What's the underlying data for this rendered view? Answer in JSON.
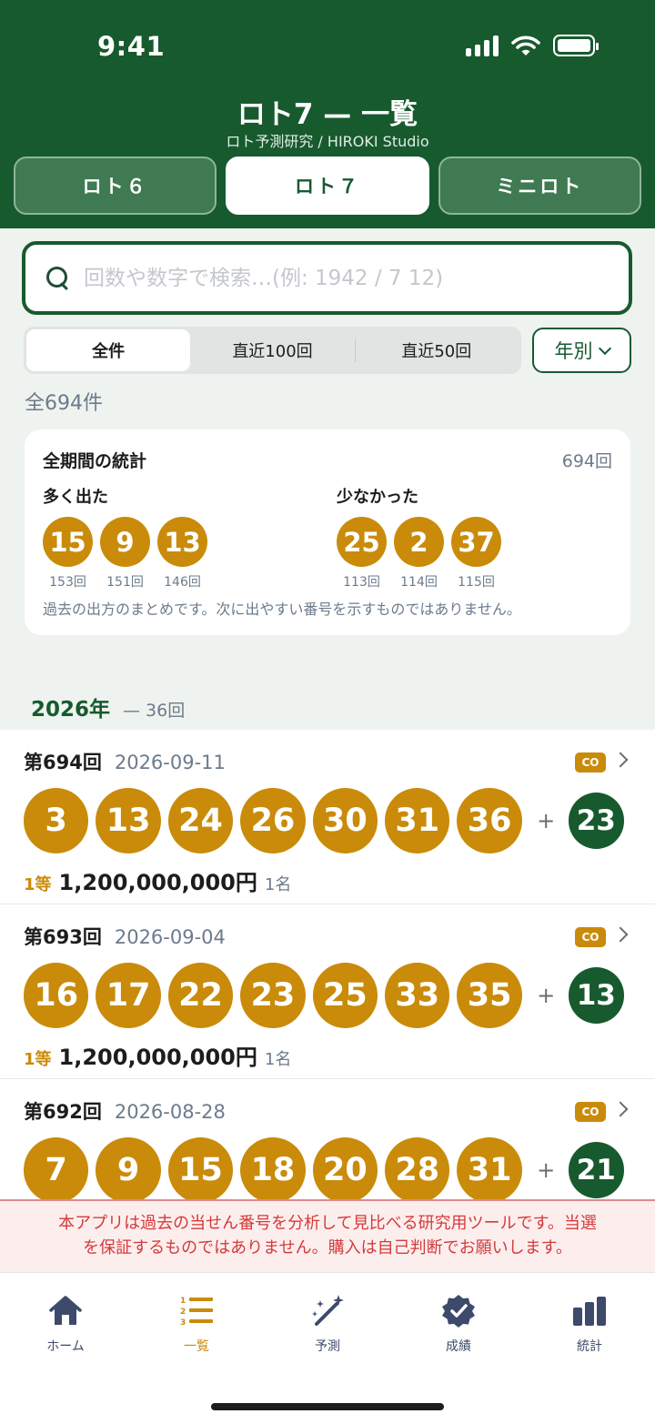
{
  "status_bar": {
    "time": "9:41"
  },
  "header": {
    "title": "ロト7 — 一覧",
    "subtitle": "ロト予測研究 / HIROKI Studio",
    "tabs": [
      {
        "label": "ロト６",
        "active": false
      },
      {
        "label": "ロト７",
        "active": true
      },
      {
        "label": "ミニロト",
        "active": false
      }
    ]
  },
  "search": {
    "placeholder": "回数や数字で検索…(例: 1942 / 7 12)",
    "value": ""
  },
  "filters": {
    "options": [
      "全件",
      "直近100回",
      "直近50回"
    ],
    "selected": "全件",
    "year_button": "年別"
  },
  "result_count": "全694件",
  "stats": {
    "title": "全期間の統計",
    "total": "694回",
    "most": {
      "label": "多く出た",
      "items": [
        {
          "number": "15",
          "count": "153回"
        },
        {
          "number": "9",
          "count": "151回"
        },
        {
          "number": "13",
          "count": "146回"
        }
      ]
    },
    "least": {
      "label": "少なかった",
      "items": [
        {
          "number": "25",
          "count": "113回"
        },
        {
          "number": "2",
          "count": "114回"
        },
        {
          "number": "37",
          "count": "115回"
        }
      ]
    },
    "note": "過去の出方のまとめです。次に出やすい番号を示すものではありません。"
  },
  "year_section": {
    "year": "2026年",
    "count": "— 36回"
  },
  "draws": [
    {
      "no": "第694回",
      "date": "2026-09-11",
      "badge": "CO",
      "numbers": [
        "3",
        "13",
        "24",
        "26",
        "30",
        "31",
        "36"
      ],
      "bonus": "23",
      "grade": "1等",
      "amount": "1,200,000,000円",
      "winners": "1名"
    },
    {
      "no": "第693回",
      "date": "2026-09-04",
      "badge": "CO",
      "numbers": [
        "16",
        "17",
        "22",
        "23",
        "25",
        "33",
        "35"
      ],
      "bonus": "13",
      "grade": "1等",
      "amount": "1,200,000,000円",
      "winners": "1名"
    },
    {
      "no": "第692回",
      "date": "2026-08-28",
      "badge": "CO",
      "numbers": [
        "7",
        "9",
        "15",
        "18",
        "20",
        "28",
        "31"
      ],
      "bonus": "21",
      "grade": "",
      "amount": "",
      "winners": ""
    }
  ],
  "disclaimer": {
    "line1": "本アプリは過去の当せん番号を分析して見比べる研究用ツールです。当選",
    "line2": "を保証するものではありません。購入は自己判断でお願いします。"
  },
  "tabbar": [
    {
      "label": "ホーム",
      "icon": "home-icon",
      "active": false
    },
    {
      "label": "一覧",
      "icon": "list-icon",
      "active": true
    },
    {
      "label": "予測",
      "icon": "magic-wand-icon",
      "active": false
    },
    {
      "label": "成績",
      "icon": "verified-badge-icon",
      "active": false
    },
    {
      "label": "統計",
      "icon": "bar-chart-icon",
      "active": false
    }
  ],
  "colors": {
    "brand_green": "#175a2e",
    "ball_gold": "#c98b09",
    "warning_red": "#d33a3a",
    "muted_text": "#6c7b8c"
  }
}
